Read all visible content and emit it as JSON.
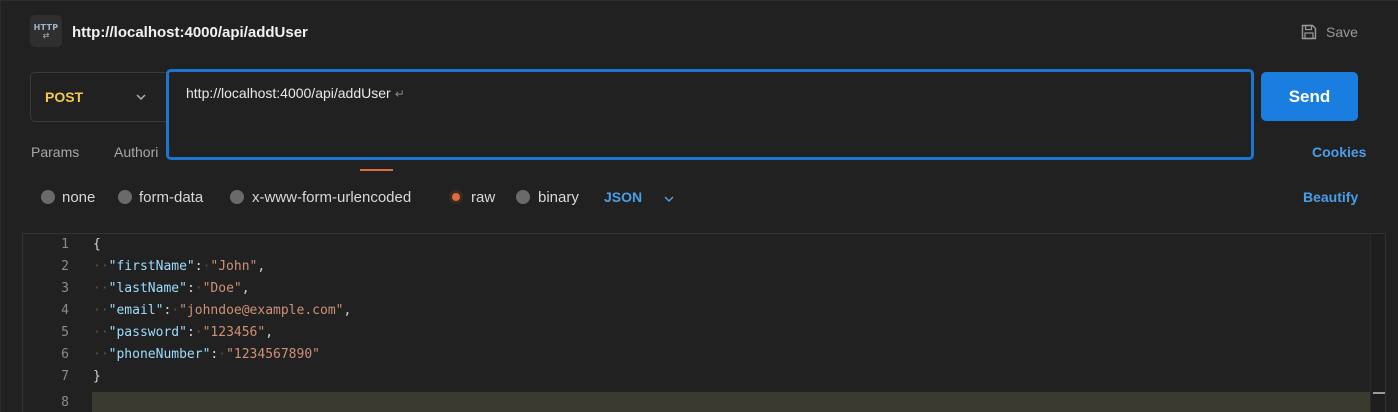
{
  "header": {
    "badge_text": "HTTP",
    "badge_arrows": "⇄",
    "title": "http://localhost:4000/api/addUser",
    "save_label": "Save"
  },
  "request": {
    "method": "POST",
    "url": "http://localhost:4000/api/addUser",
    "send_label": "Send"
  },
  "tabs": {
    "params": "Params",
    "auth": "Authori",
    "cookies": "Cookies"
  },
  "body_types": {
    "none": "none",
    "form_data": "form-data",
    "urlencoded": "x-www-form-urlencoded",
    "raw": "raw",
    "binary": "binary",
    "selected": "raw",
    "format": "JSON",
    "beautify": "Beautify"
  },
  "editor": {
    "line_numbers": [
      "1",
      "2",
      "3",
      "4",
      "5",
      "6",
      "7",
      "8"
    ],
    "open_brace": "{",
    "close_brace": "}",
    "fields": [
      {
        "key": "\"firstName\"",
        "value": "\"John\"",
        "comma": ","
      },
      {
        "key": "\"lastName\"",
        "value": "\"Doe\"",
        "comma": ","
      },
      {
        "key": "\"email\"",
        "value": "\"johndoe@example.com\"",
        "comma": ","
      },
      {
        "key": "\"password\"",
        "value": "\"123456\"",
        "comma": ","
      },
      {
        "key": "\"phoneNumber\"",
        "value": "\"1234567890\"",
        "comma": ""
      }
    ]
  },
  "colors": {
    "accent_blue": "#1a7de0",
    "method_yellow": "#f2c94c",
    "active_orange": "#e06b3b",
    "link_blue": "#4a9ee8"
  }
}
